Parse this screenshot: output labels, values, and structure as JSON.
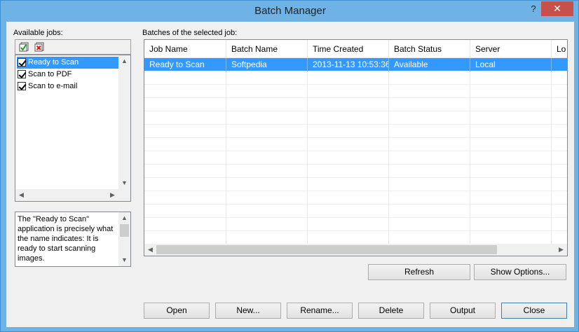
{
  "window": {
    "title": "Batch Manager",
    "help_glyph": "?",
    "close_glyph": "✕"
  },
  "jobs": {
    "label": "Available jobs:",
    "toolbar_icons": [
      "check-all-icon",
      "uncheck-all-icon"
    ],
    "items": [
      {
        "label": "Ready to Scan",
        "checked": true,
        "selected": true
      },
      {
        "label": "Scan to PDF",
        "checked": true,
        "selected": false
      },
      {
        "label": "Scan to e-mail",
        "checked": true,
        "selected": false
      }
    ],
    "description": "The \"Ready to Scan\" application is precisely what the name indicates: It is ready to start scanning images."
  },
  "batches": {
    "label": "Batches of the selected job:",
    "columns": [
      "Job Name",
      "Batch Name",
      "Time Created",
      "Batch Status",
      "Server",
      "Lo"
    ],
    "rows": [
      [
        "Ready to Scan",
        "Softpedia",
        "2013-11-13 10:53:36",
        "Available",
        "Local",
        ""
      ]
    ]
  },
  "buttons": {
    "refresh": "Refresh",
    "show_options": "Show Options...",
    "open": "Open",
    "new": "New...",
    "rename": "Rename...",
    "delete": "Delete",
    "output": "Output",
    "close": "Close"
  },
  "colors": {
    "titlebar": "#6fb2e6",
    "selection": "#3399ff",
    "close_button": "#c7504b"
  }
}
